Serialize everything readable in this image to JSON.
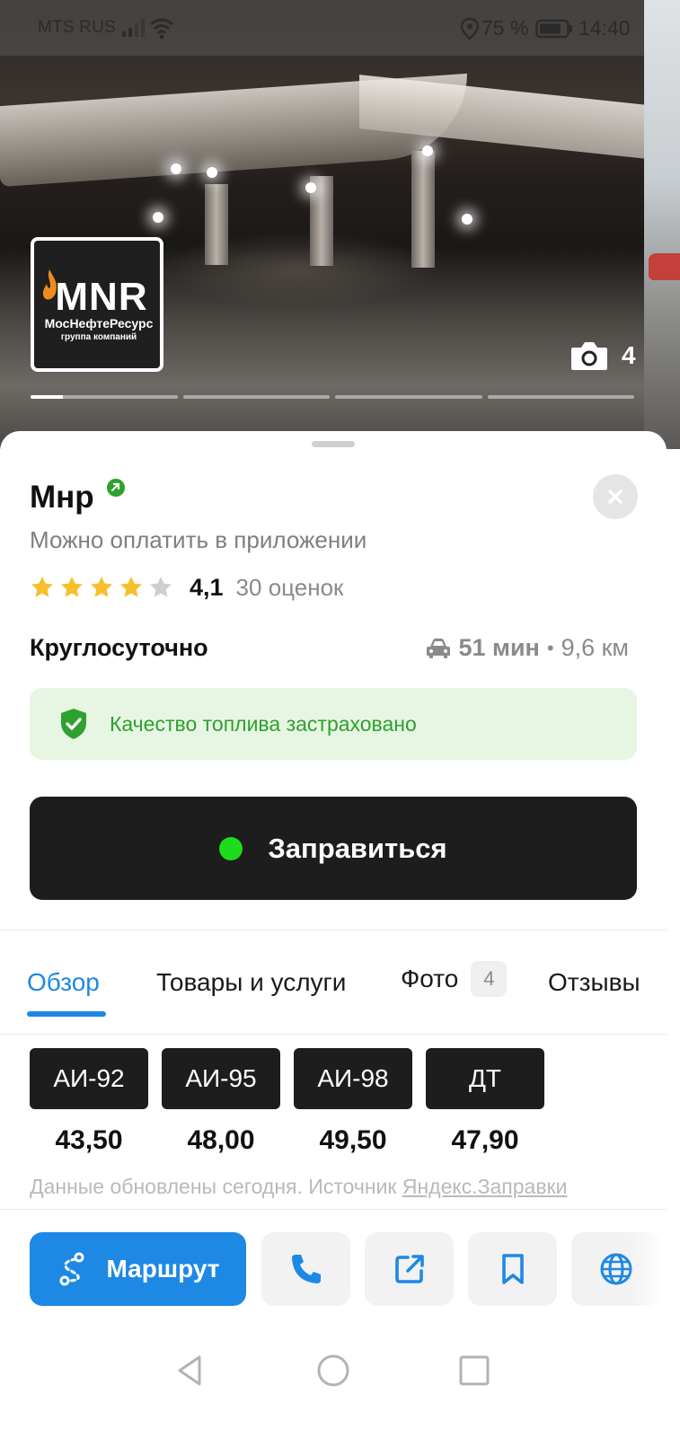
{
  "status_bar": {
    "carrier": "MTS RUS",
    "battery_percent": "75 %",
    "time": "14:40"
  },
  "photo": {
    "logo_text": "MNR",
    "logo_subtitle": "МосНефтеРесурс",
    "logo_tagline": "группа компаний",
    "photo_count": "4",
    "carousel_position": 0.22
  },
  "place": {
    "title": "Мнр",
    "subtitle": "Можно оплатить в приложении",
    "rating_value": "4,1",
    "rating_stars": 4,
    "rating_count": "30 оценок",
    "hours": "Круглосуточно",
    "eta_time": "51 мин",
    "eta_separator": "•",
    "eta_distance": "9,6 км",
    "insurance_text": "Качество топлива застраховано",
    "cta_label": "Заправиться"
  },
  "tabs": [
    {
      "label": "Обзор",
      "active": true
    },
    {
      "label": "Товары и услуги",
      "active": false
    },
    {
      "label": "Фото",
      "badge": "4",
      "active": false
    },
    {
      "label": "Отзывы",
      "active": false
    }
  ],
  "fuel": [
    {
      "type": "АИ-92",
      "price": "43,50"
    },
    {
      "type": "АИ-95",
      "price": "48,00"
    },
    {
      "type": "АИ-98",
      "price": "49,50"
    },
    {
      "type": "ДТ",
      "price": "47,90"
    }
  ],
  "source": {
    "prefix": "Данные обновлены сегодня. Источник ",
    "link": "Яндекс.Заправки"
  },
  "actions": {
    "route_label": "Маршрут",
    "buttons": [
      "phone-icon",
      "share-icon",
      "bookmark-icon",
      "globe-icon"
    ]
  },
  "colors": {
    "accent": "#1e88e5",
    "cta_background": "#1d1d1d",
    "cta_dot": "#1edb1e",
    "insurance_bg": "#e7f5e3",
    "insurance_text": "#2ea12e",
    "star": "#f6c02d",
    "verified": "#2ea12e"
  }
}
